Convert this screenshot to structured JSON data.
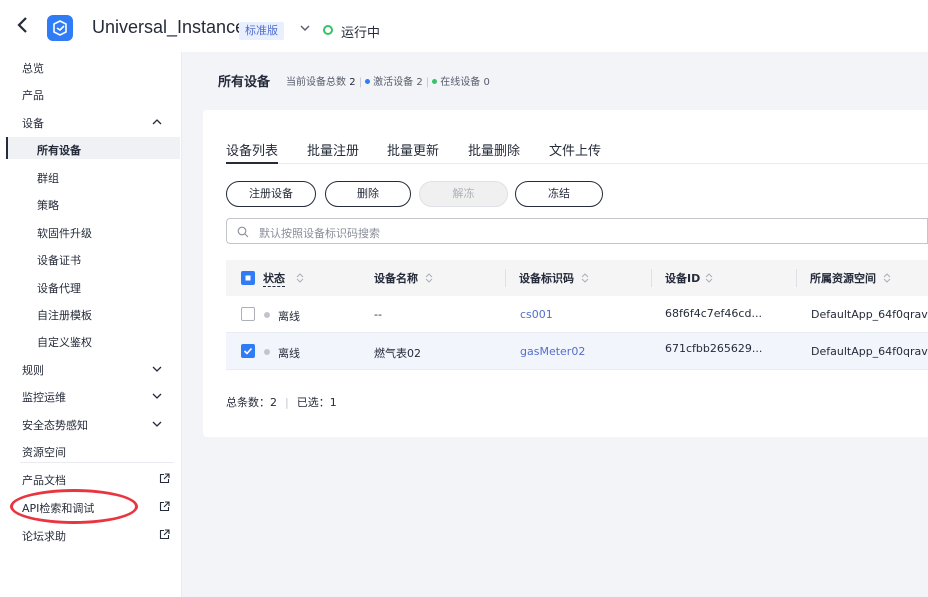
{
  "header": {
    "instance_name": "Universal_Instance",
    "edition_badge": "标准版",
    "status": "运行中",
    "colors": {
      "accent": "#2f7cf6",
      "status_ok": "#3ac26a"
    }
  },
  "sidebar": {
    "items": [
      {
        "label": "总览"
      },
      {
        "label": "产品"
      },
      {
        "label": "设备"
      },
      {
        "label": "所有设备"
      },
      {
        "label": "群组"
      },
      {
        "label": "策略"
      },
      {
        "label": "软固件升级"
      },
      {
        "label": "设备证书"
      },
      {
        "label": "设备代理"
      },
      {
        "label": "自注册模板"
      },
      {
        "label": "自定义鉴权"
      },
      {
        "label": "规则"
      },
      {
        "label": "监控运维"
      },
      {
        "label": "安全态势感知"
      },
      {
        "label": "资源空间"
      },
      {
        "label": "产品文档"
      },
      {
        "label": "API检索和调试"
      },
      {
        "label": "论坛求助"
      }
    ]
  },
  "page": {
    "title": "所有设备",
    "total_label": "当前设备总数",
    "total_value": "2",
    "active_label": "激活设备",
    "active_value": "2",
    "online_label": "在线设备",
    "online_value": "0"
  },
  "tabs": [
    "设备列表",
    "批量注册",
    "批量更新",
    "批量删除",
    "文件上传"
  ],
  "toolbar": {
    "register": "注册设备",
    "delete": "删除",
    "unfreeze": "解冻",
    "freeze": "冻结"
  },
  "search": {
    "placeholder": "默认按照设备标识码搜索"
  },
  "table": {
    "columns": [
      "状态",
      "设备名称",
      "设备标识码",
      "设备ID",
      "所属资源空间"
    ],
    "rows": [
      {
        "status": "离线",
        "name": "--",
        "identifier": "cs001",
        "device_id": "68f6f4c7ef46cd...",
        "space": "DefaultApp_64f0qrav",
        "checked": false
      },
      {
        "status": "离线",
        "name": "燃气表02",
        "identifier": "gasMeter02",
        "device_id": "671cfbb265629...",
        "space": "DefaultApp_64f0qrav",
        "checked": true
      }
    ]
  },
  "footer": {
    "total_label": "总条数：",
    "total_value": "2",
    "selected_label": "已选：",
    "selected_value": "1"
  }
}
